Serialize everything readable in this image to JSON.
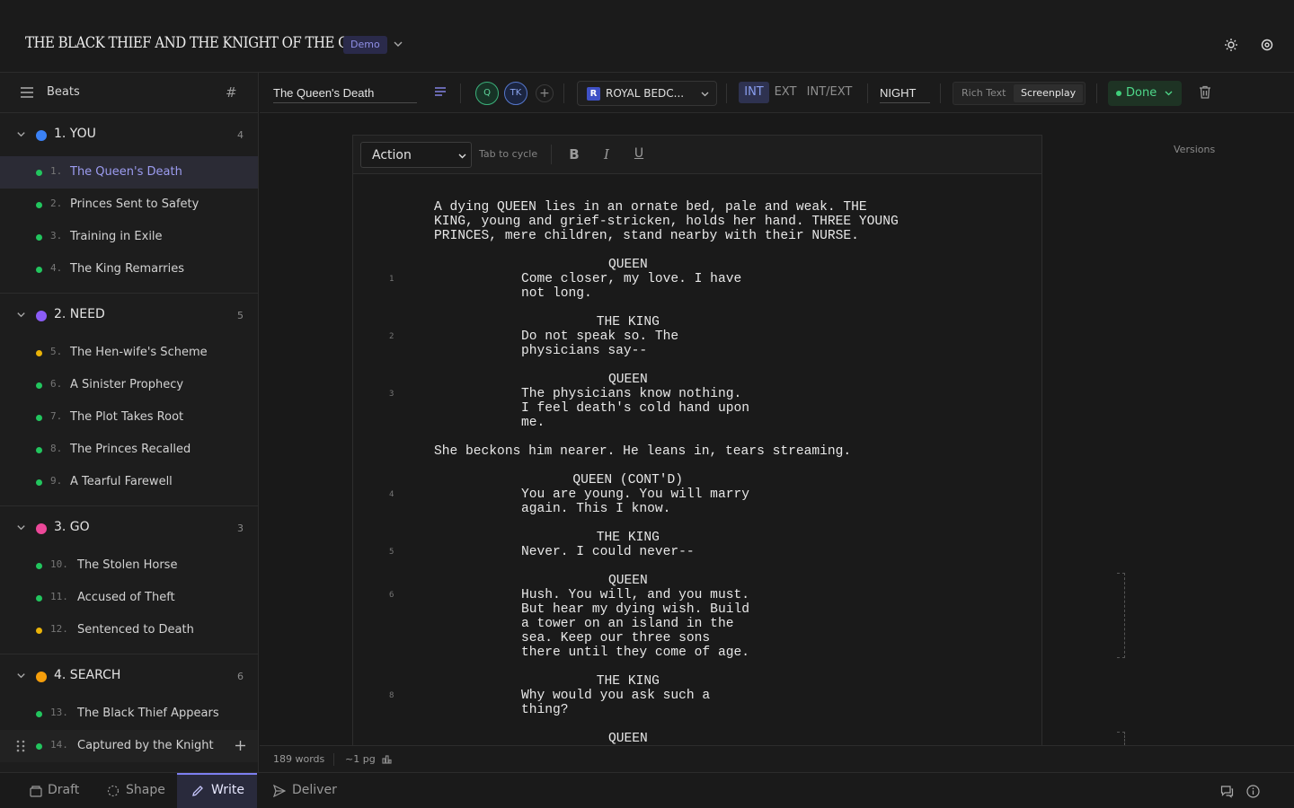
{
  "header": {
    "project_title": "THE BLACK THIEF AND THE KNIGHT OF THE GLEN",
    "demo_badge": "Demo"
  },
  "sidebar": {
    "title": "Beats",
    "hash_symbol": "#",
    "acts": [
      {
        "title": "1. YOU",
        "count": "4",
        "color": "#3b82f6"
      },
      {
        "title": "2. NEED",
        "count": "5",
        "color": "#8b5cf6"
      },
      {
        "title": "3. GO",
        "count": "3",
        "color": "#ec4899"
      },
      {
        "title": "4. SEARCH",
        "count": "6",
        "color": "#f59e0b"
      }
    ],
    "beats": [
      {
        "num": "1.",
        "label": "The Queen's Death",
        "color": "#22c55e"
      },
      {
        "num": "2.",
        "label": "Princes Sent to Safety",
        "color": "#22c55e"
      },
      {
        "num": "3.",
        "label": "Training in Exile",
        "color": "#22c55e"
      },
      {
        "num": "4.",
        "label": "The King Remarries",
        "color": "#22c55e"
      },
      {
        "num": "5.",
        "label": "The Hen-wife's Scheme",
        "color": "#eab308"
      },
      {
        "num": "6.",
        "label": "A Sinister Prophecy",
        "color": "#22c55e"
      },
      {
        "num": "7.",
        "label": "The Plot Takes Root",
        "color": "#22c55e"
      },
      {
        "num": "8.",
        "label": "The Princes Recalled",
        "color": "#22c55e"
      },
      {
        "num": "9.",
        "label": "A Tearful Farewell",
        "color": "#22c55e"
      },
      {
        "num": "10.",
        "label": "The Stolen Horse",
        "color": "#22c55e"
      },
      {
        "num": "11.",
        "label": "Accused of Theft",
        "color": "#22c55e"
      },
      {
        "num": "12.",
        "label": "Sentenced to Death",
        "color": "#eab308"
      },
      {
        "num": "13.",
        "label": "The Black Thief Appears",
        "color": "#22c55e"
      },
      {
        "num": "14.",
        "label": "Captured by the Knight",
        "color": "#22c55e"
      }
    ]
  },
  "toolbar": {
    "scene_title": "The Queen's Death",
    "avatars": [
      "Q",
      "TK"
    ],
    "add_collaborator": "+",
    "location_badge": "R",
    "location": "ROYAL BEDC...",
    "int_options": [
      "INT",
      "EXT",
      "INT/EXT"
    ],
    "time_of_day": "NIGHT",
    "format_rich": "Rich Text",
    "format_screenplay": "Screenplay",
    "status": "Done"
  },
  "editor": {
    "element_type": "Action",
    "tab_hint": "Tab to cycle",
    "bold": "B",
    "italic": "I",
    "underline": "U",
    "lines": [
      {
        "text": "A dying QUEEN lies in an ornate bed, pale and weak. THE",
        "indent": "action"
      },
      {
        "text": "KING, young and grief-stricken, holds her hand. THREE YOUNG",
        "indent": "action"
      },
      {
        "text": "PRINCES, mere children, stand nearby with their NURSE.",
        "indent": "action"
      },
      {
        "text": "QUEEN",
        "indent": "character"
      },
      {
        "text": "Come closer, my love. I have",
        "indent": "dialogue",
        "num": "1"
      },
      {
        "text": "not long.",
        "indent": "dialogue"
      },
      {
        "text": "THE KING",
        "indent": "character"
      },
      {
        "text": "Do not speak so. The",
        "indent": "dialogue",
        "num": "2"
      },
      {
        "text": "physicians say--",
        "indent": "dialogue"
      },
      {
        "text": "QUEEN",
        "indent": "character"
      },
      {
        "text": "The physicians know nothing.",
        "indent": "dialogue",
        "num": "3"
      },
      {
        "text": "I feel death's cold hand upon",
        "indent": "dialogue"
      },
      {
        "text": "me.",
        "indent": "dialogue"
      },
      {
        "text": "She beckons him nearer. He leans in, tears streaming.",
        "indent": "action"
      },
      {
        "text": "QUEEN (CONT'D)",
        "indent": "character"
      },
      {
        "text": "You are young. You will marry",
        "indent": "dialogue",
        "num": "4"
      },
      {
        "text": "again. This I know.",
        "indent": "dialogue"
      },
      {
        "text": "THE KING",
        "indent": "character"
      },
      {
        "text": "Never. I could never--",
        "indent": "dialogue",
        "num": "5"
      },
      {
        "text": "QUEEN",
        "indent": "character"
      },
      {
        "text": "Hush. You will, and you must.",
        "indent": "dialogue",
        "num": "6"
      },
      {
        "text": "But hear my dying wish. Build",
        "indent": "dialogue"
      },
      {
        "text": "a tower on an island in the",
        "indent": "dialogue"
      },
      {
        "text": "sea. Keep our three sons",
        "indent": "dialogue"
      },
      {
        "text": "there until they come of age.",
        "indent": "dialogue"
      },
      {
        "text": "THE KING",
        "indent": "character"
      },
      {
        "text": "Why would you ask such a",
        "indent": "dialogue",
        "num": "8"
      },
      {
        "text": "thing?",
        "indent": "dialogue"
      },
      {
        "text": "QUEEN",
        "indent": "character"
      }
    ]
  },
  "versions_label": "Versions",
  "status_bar": {
    "words": "189 words",
    "pages": "~1 pg"
  },
  "bottom_tabs": [
    {
      "label": "Draft",
      "icon": "box-icon"
    },
    {
      "label": "Shape",
      "icon": "sparkle-icon"
    },
    {
      "label": "Write",
      "icon": "pencil-icon"
    },
    {
      "label": "Deliver",
      "icon": "send-icon"
    }
  ],
  "colors": {
    "accent": "#7d7ff0",
    "status_done": "#4fd88a"
  }
}
